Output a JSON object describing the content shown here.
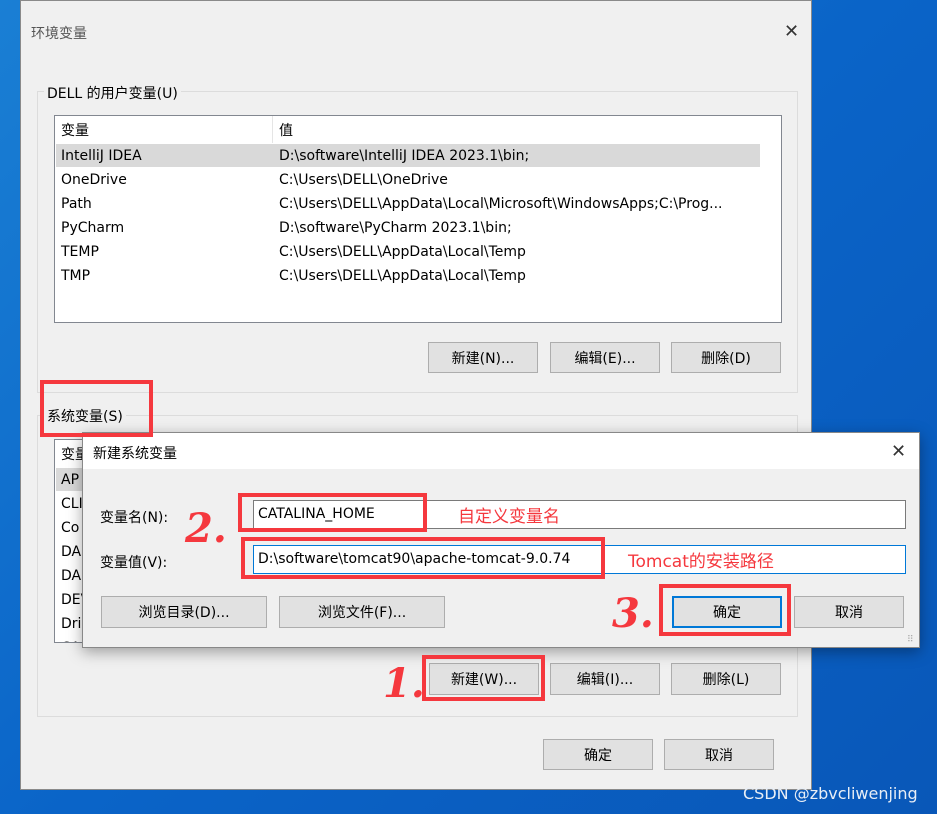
{
  "window": {
    "title": "环境变量",
    "close": "✕"
  },
  "user_vars": {
    "label": "DELL 的用户变量(U)",
    "headers": [
      "变量",
      "值"
    ],
    "rows": [
      [
        "IntelliJ IDEA",
        "D:\\software\\IntelliJ IDEA 2023.1\\bin;"
      ],
      [
        "OneDrive",
        "C:\\Users\\DELL\\OneDrive"
      ],
      [
        "Path",
        "C:\\Users\\DELL\\AppData\\Local\\Microsoft\\WindowsApps;C:\\Prog..."
      ],
      [
        "PyCharm",
        "D:\\software\\PyCharm 2023.1\\bin;"
      ],
      [
        "TEMP",
        "C:\\Users\\DELL\\AppData\\Local\\Temp"
      ],
      [
        "TMP",
        "C:\\Users\\DELL\\AppData\\Local\\Temp"
      ]
    ],
    "buttons": {
      "new": "新建(N)...",
      "edit": "编辑(E)...",
      "delete": "删除(D)"
    }
  },
  "sys_vars": {
    "label": "系统变量(S)",
    "header": "变量",
    "rows": [
      "AP",
      "CLI",
      "Co",
      "DA",
      "DA",
      "DEV",
      "Dri",
      "CA"
    ],
    "buttons": {
      "new": "新建(W)...",
      "edit": "编辑(I)...",
      "delete": "删除(L)"
    }
  },
  "footer": {
    "ok": "确定",
    "cancel": "取消"
  },
  "dialog": {
    "title": "新建系统变量",
    "close": "✕",
    "name_label": "变量名(N):",
    "name_value": "CATALINA_HOME",
    "value_label": "变量值(V):",
    "value_value": "D:\\software\\tomcat90\\apache-tomcat-9.0.74",
    "browse_dir": "浏览目录(D)...",
    "browse_file": "浏览文件(F)...",
    "ok": "确定",
    "cancel": "取消"
  },
  "annotations": {
    "name_note": "自定义变量名",
    "value_note": "Tomcat的安装路径",
    "step1": "1.",
    "step2": "2.",
    "step3": "3.",
    "accent": "#f5383e"
  },
  "watermark": "CSDN @zbvcliwenjing"
}
